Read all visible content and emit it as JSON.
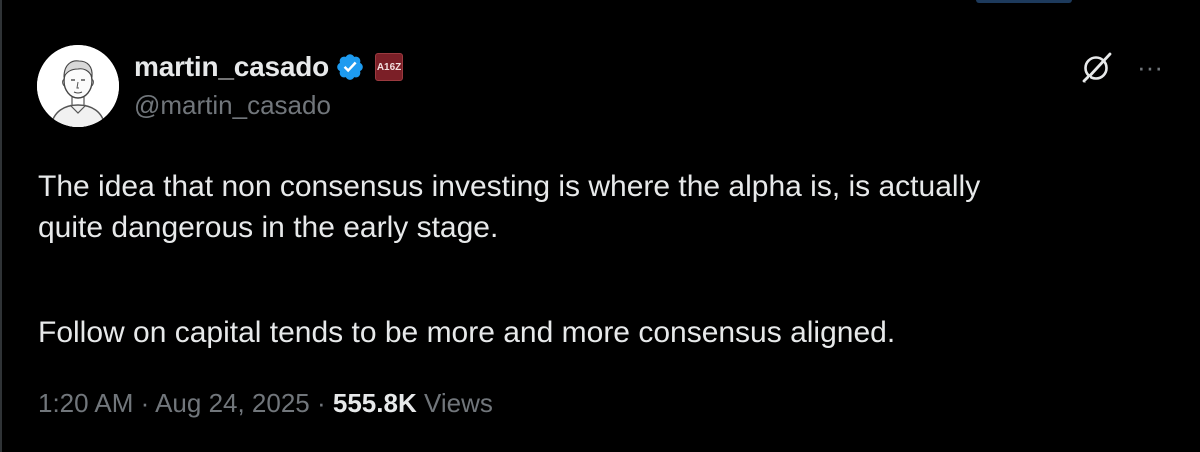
{
  "author": {
    "display_name": "martin_casado",
    "handle": "@martin_casado",
    "verified_icon": "verified-badge-icon",
    "affiliation_badge": "A16Z"
  },
  "tweet": {
    "line1": "The idea that non consensus investing is where the alpha is, is actually",
    "line2": "quite dangerous in the early stage.",
    "line3": "Follow on capital tends to be more and more consensus aligned."
  },
  "meta": {
    "time": "1:20 AM",
    "sep1": " · ",
    "date": "Aug 24, 2025",
    "sep2": " · ",
    "views_count": "555.8K",
    "views_label": " Views"
  },
  "actions": {
    "grok_icon": "grok-icon",
    "more_icon": "more-icon",
    "more_glyph": "···"
  },
  "colors": {
    "background": "#000000",
    "text_primary": "#e7e9ea",
    "text_secondary": "#71767b",
    "verified": "#1d9bf0",
    "affiliation": "#7b1f27"
  }
}
